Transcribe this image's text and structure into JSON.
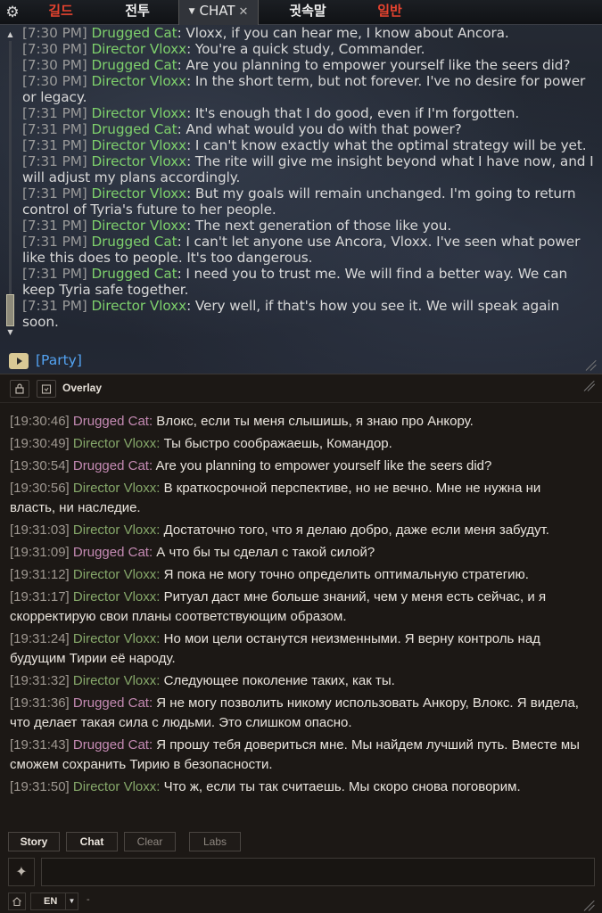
{
  "game_chat": {
    "tabs": [
      {
        "label": "길드",
        "color": "#e6432f"
      },
      {
        "label": "전투",
        "color": "#f0f0f0"
      },
      {
        "label": "CHAT",
        "color": "#e8e8e8",
        "active": true
      },
      {
        "label": "귓속말",
        "color": "#f0f0f0"
      },
      {
        "label": "일반",
        "color": "#e6432f"
      }
    ],
    "speaker_colors": {
      "Drugged Cat": "#7ed06c",
      "Director Vloxx": "#7ed06c"
    },
    "messages": [
      {
        "time": "[7:30 PM]",
        "speaker": "Drugged Cat",
        "text": ": Vloxx, if you can hear me, I know about Ancora."
      },
      {
        "time": "[7:30 PM]",
        "speaker": "Director Vloxx",
        "text": ": You're a quick study, Commander."
      },
      {
        "time": "[7:30 PM]",
        "speaker": "Drugged Cat",
        "text": ": Are you planning to empower yourself like the seers did?"
      },
      {
        "time": "[7:30 PM]",
        "speaker": "Director Vloxx",
        "text": ": In the short term, but not forever. I've no desire for power or legacy."
      },
      {
        "time": "[7:31 PM]",
        "speaker": "Director Vloxx",
        "text": ": It's enough that I do good, even if I'm forgotten."
      },
      {
        "time": "[7:31 PM]",
        "speaker": "Drugged Cat",
        "text": ": And what would you do with that power?"
      },
      {
        "time": "[7:31 PM]",
        "speaker": "Director Vloxx",
        "text": ": I can't know exactly what the optimal strategy will be yet."
      },
      {
        "time": "[7:31 PM]",
        "speaker": "Director Vloxx",
        "text": ": The rite will give me insight beyond what I have now, and I will adjust my plans accordingly."
      },
      {
        "time": "[7:31 PM]",
        "speaker": "Director Vloxx",
        "text": ": But my goals will remain unchanged. I'm going to return control of Tyria's future to her people."
      },
      {
        "time": "[7:31 PM]",
        "speaker": "Director Vloxx",
        "text": ": The next generation of those like you."
      },
      {
        "time": "[7:31 PM]",
        "speaker": "Drugged Cat",
        "text": ": I can't let anyone use Ancora, Vloxx. I've seen what power like this does to people. It's too dangerous."
      },
      {
        "time": "[7:31 PM]",
        "speaker": "Drugged Cat",
        "text": ": I need you to trust me. We will find a better way. We can keep Tyria safe together."
      },
      {
        "time": "[7:31 PM]",
        "speaker": "Director Vloxx",
        "text": ": Very well, if that's how you see it. We will speak again soon."
      }
    ],
    "party_label": "[Party]",
    "scroll_position": 0.9
  },
  "overlay": {
    "title": "Overlay",
    "lock_icon": "lock-icon",
    "clock_icon": "alarm-clock-icon",
    "speaker_colors": {
      "Drugged Cat": "#c48ab3",
      "Director Vloxx": "#86a86a"
    },
    "messages": [
      {
        "time": "[19:30:46]",
        "speaker": "Drugged Cat",
        "text": " Влокс, если ты меня слышишь, я знаю про Анкору."
      },
      {
        "time": "[19:30:49]",
        "speaker": "Director Vloxx",
        "text": " Ты быстро соображаешь, Командор."
      },
      {
        "time": "[19:30:54]",
        "speaker": "Drugged Cat",
        "text": " Are you planning to empower yourself like the seers did?"
      },
      {
        "time": "[19:30:56]",
        "speaker": "Director Vloxx",
        "text": " В краткосрочной перспективе, но не вечно. Мне не нужна ни власть, ни наследие."
      },
      {
        "time": "[19:31:03]",
        "speaker": "Director Vloxx",
        "text": " Достаточно того, что я делаю добро, даже если меня забудут."
      },
      {
        "time": "[19:31:09]",
        "speaker": "Drugged Cat",
        "text": " А что бы ты сделал с такой силой?"
      },
      {
        "time": "[19:31:12]",
        "speaker": "Director Vloxx",
        "text": " Я пока не могу точно определить оптимальную стратегию."
      },
      {
        "time": "[19:31:17]",
        "speaker": "Director Vloxx",
        "text": " Ритуал даст мне больше знаний, чем у меня есть сейчас, и я скорректирую свои планы соответствующим образом."
      },
      {
        "time": "[19:31:24]",
        "speaker": "Director Vloxx",
        "text": " Но мои цели останутся неизменными. Я верну контроль над будущим Тирии её народу."
      },
      {
        "time": "[19:31:32]",
        "speaker": "Director Vloxx",
        "text": " Следующее поколение таких, как ты."
      },
      {
        "time": "[19:31:36]",
        "speaker": "Drugged Cat",
        "text": " Я не могу позволить никому использовать Анкору, Влокс. Я видела, что делает такая сила с людьми. Это слишком опасно."
      },
      {
        "time": "[19:31:43]",
        "speaker": "Drugged Cat",
        "text": " Я прошу тебя довериться мне. Мы найдем лучший путь. Вместе мы сможем сохранить Тирию в безопасности."
      },
      {
        "time": "[19:31:50]",
        "speaker": "Director Vloxx",
        "text": " Что ж, если ты так считаешь. Мы скоро снова поговорим."
      }
    ],
    "footer": {
      "buttons": [
        {
          "label": "Story",
          "style": "bold"
        },
        {
          "label": "Chat",
          "style": "bold"
        },
        {
          "label": "Clear",
          "style": "dim"
        },
        {
          "label": "Labs",
          "style": "dim"
        }
      ],
      "input_icon": "sparkle-icon",
      "input_placeholder": "",
      "home_icon": "home-icon",
      "language": "EN",
      "language_note": "-"
    }
  }
}
